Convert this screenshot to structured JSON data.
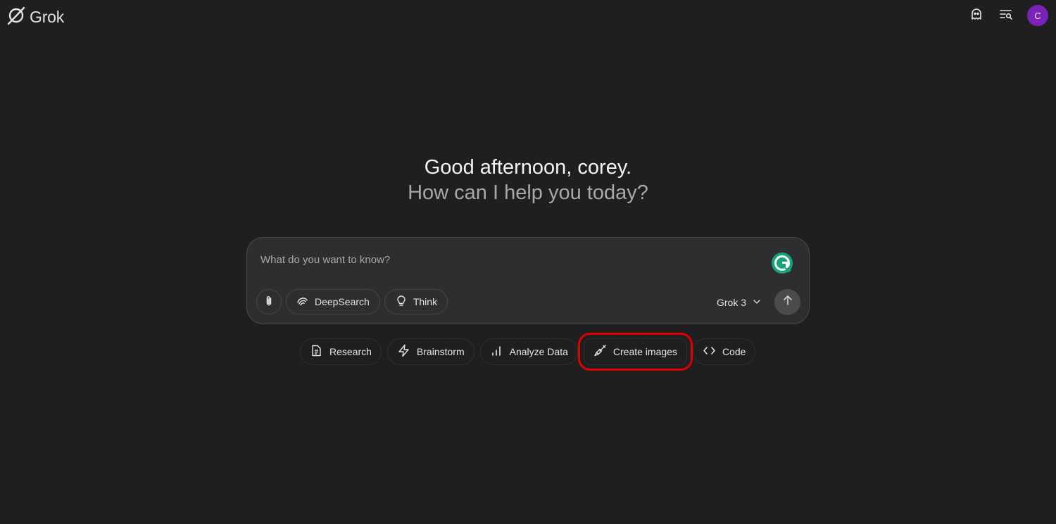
{
  "app": {
    "logo_text": "Grok",
    "logo_icon": "grok-logo-icon"
  },
  "header": {
    "actions": [
      {
        "name": "ghost-icon",
        "label": "Private chat"
      },
      {
        "name": "history-search-icon",
        "label": "Chat history"
      }
    ],
    "avatar_initial": "C",
    "avatar_color": "#7b22b8"
  },
  "greeting": {
    "line1": "Good afternoon, corey.",
    "line2": "How can I help you today?"
  },
  "composer": {
    "placeholder": "What do you want to know?",
    "value": "",
    "attach_icon": "paperclip-icon",
    "tools": [
      {
        "label": "DeepSearch",
        "icon": "deepsearch-icon"
      },
      {
        "label": "Think",
        "icon": "lightbulb-icon"
      }
    ],
    "model": "Grok 3",
    "send_icon": "arrow-up-icon"
  },
  "suggestions": [
    {
      "label": "Research",
      "icon": "document-icon"
    },
    {
      "label": "Brainstorm",
      "icon": "lightning-icon"
    },
    {
      "label": "Analyze Data",
      "icon": "bar-chart-icon"
    },
    {
      "label": "Create images",
      "icon": "paintbrush-icon",
      "highlighted": true
    },
    {
      "label": "Code",
      "icon": "code-icon"
    }
  ],
  "colors": {
    "background": "#1f1f21",
    "composer_bg": "#2e2e30",
    "highlight_outline": "#e00000",
    "grammarly": "#15a37a"
  }
}
